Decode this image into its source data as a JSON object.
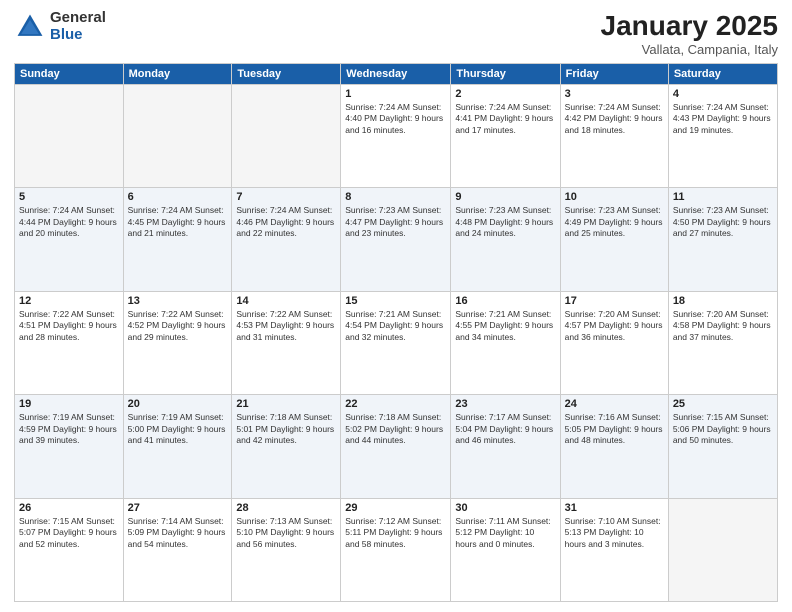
{
  "header": {
    "logo_general": "General",
    "logo_blue": "Blue",
    "month_title": "January 2025",
    "location": "Vallata, Campania, Italy"
  },
  "days_of_week": [
    "Sunday",
    "Monday",
    "Tuesday",
    "Wednesday",
    "Thursday",
    "Friday",
    "Saturday"
  ],
  "weeks": [
    [
      {
        "day": "",
        "info": ""
      },
      {
        "day": "",
        "info": ""
      },
      {
        "day": "",
        "info": ""
      },
      {
        "day": "1",
        "info": "Sunrise: 7:24 AM\nSunset: 4:40 PM\nDaylight: 9 hours\nand 16 minutes."
      },
      {
        "day": "2",
        "info": "Sunrise: 7:24 AM\nSunset: 4:41 PM\nDaylight: 9 hours\nand 17 minutes."
      },
      {
        "day": "3",
        "info": "Sunrise: 7:24 AM\nSunset: 4:42 PM\nDaylight: 9 hours\nand 18 minutes."
      },
      {
        "day": "4",
        "info": "Sunrise: 7:24 AM\nSunset: 4:43 PM\nDaylight: 9 hours\nand 19 minutes."
      }
    ],
    [
      {
        "day": "5",
        "info": "Sunrise: 7:24 AM\nSunset: 4:44 PM\nDaylight: 9 hours\nand 20 minutes."
      },
      {
        "day": "6",
        "info": "Sunrise: 7:24 AM\nSunset: 4:45 PM\nDaylight: 9 hours\nand 21 minutes."
      },
      {
        "day": "7",
        "info": "Sunrise: 7:24 AM\nSunset: 4:46 PM\nDaylight: 9 hours\nand 22 minutes."
      },
      {
        "day": "8",
        "info": "Sunrise: 7:23 AM\nSunset: 4:47 PM\nDaylight: 9 hours\nand 23 minutes."
      },
      {
        "day": "9",
        "info": "Sunrise: 7:23 AM\nSunset: 4:48 PM\nDaylight: 9 hours\nand 24 minutes."
      },
      {
        "day": "10",
        "info": "Sunrise: 7:23 AM\nSunset: 4:49 PM\nDaylight: 9 hours\nand 25 minutes."
      },
      {
        "day": "11",
        "info": "Sunrise: 7:23 AM\nSunset: 4:50 PM\nDaylight: 9 hours\nand 27 minutes."
      }
    ],
    [
      {
        "day": "12",
        "info": "Sunrise: 7:22 AM\nSunset: 4:51 PM\nDaylight: 9 hours\nand 28 minutes."
      },
      {
        "day": "13",
        "info": "Sunrise: 7:22 AM\nSunset: 4:52 PM\nDaylight: 9 hours\nand 29 minutes."
      },
      {
        "day": "14",
        "info": "Sunrise: 7:22 AM\nSunset: 4:53 PM\nDaylight: 9 hours\nand 31 minutes."
      },
      {
        "day": "15",
        "info": "Sunrise: 7:21 AM\nSunset: 4:54 PM\nDaylight: 9 hours\nand 32 minutes."
      },
      {
        "day": "16",
        "info": "Sunrise: 7:21 AM\nSunset: 4:55 PM\nDaylight: 9 hours\nand 34 minutes."
      },
      {
        "day": "17",
        "info": "Sunrise: 7:20 AM\nSunset: 4:57 PM\nDaylight: 9 hours\nand 36 minutes."
      },
      {
        "day": "18",
        "info": "Sunrise: 7:20 AM\nSunset: 4:58 PM\nDaylight: 9 hours\nand 37 minutes."
      }
    ],
    [
      {
        "day": "19",
        "info": "Sunrise: 7:19 AM\nSunset: 4:59 PM\nDaylight: 9 hours\nand 39 minutes."
      },
      {
        "day": "20",
        "info": "Sunrise: 7:19 AM\nSunset: 5:00 PM\nDaylight: 9 hours\nand 41 minutes."
      },
      {
        "day": "21",
        "info": "Sunrise: 7:18 AM\nSunset: 5:01 PM\nDaylight: 9 hours\nand 42 minutes."
      },
      {
        "day": "22",
        "info": "Sunrise: 7:18 AM\nSunset: 5:02 PM\nDaylight: 9 hours\nand 44 minutes."
      },
      {
        "day": "23",
        "info": "Sunrise: 7:17 AM\nSunset: 5:04 PM\nDaylight: 9 hours\nand 46 minutes."
      },
      {
        "day": "24",
        "info": "Sunrise: 7:16 AM\nSunset: 5:05 PM\nDaylight: 9 hours\nand 48 minutes."
      },
      {
        "day": "25",
        "info": "Sunrise: 7:15 AM\nSunset: 5:06 PM\nDaylight: 9 hours\nand 50 minutes."
      }
    ],
    [
      {
        "day": "26",
        "info": "Sunrise: 7:15 AM\nSunset: 5:07 PM\nDaylight: 9 hours\nand 52 minutes."
      },
      {
        "day": "27",
        "info": "Sunrise: 7:14 AM\nSunset: 5:09 PM\nDaylight: 9 hours\nand 54 minutes."
      },
      {
        "day": "28",
        "info": "Sunrise: 7:13 AM\nSunset: 5:10 PM\nDaylight: 9 hours\nand 56 minutes."
      },
      {
        "day": "29",
        "info": "Sunrise: 7:12 AM\nSunset: 5:11 PM\nDaylight: 9 hours\nand 58 minutes."
      },
      {
        "day": "30",
        "info": "Sunrise: 7:11 AM\nSunset: 5:12 PM\nDaylight: 10 hours\nand 0 minutes."
      },
      {
        "day": "31",
        "info": "Sunrise: 7:10 AM\nSunset: 5:13 PM\nDaylight: 10 hours\nand 3 minutes."
      },
      {
        "day": "",
        "info": ""
      }
    ]
  ]
}
